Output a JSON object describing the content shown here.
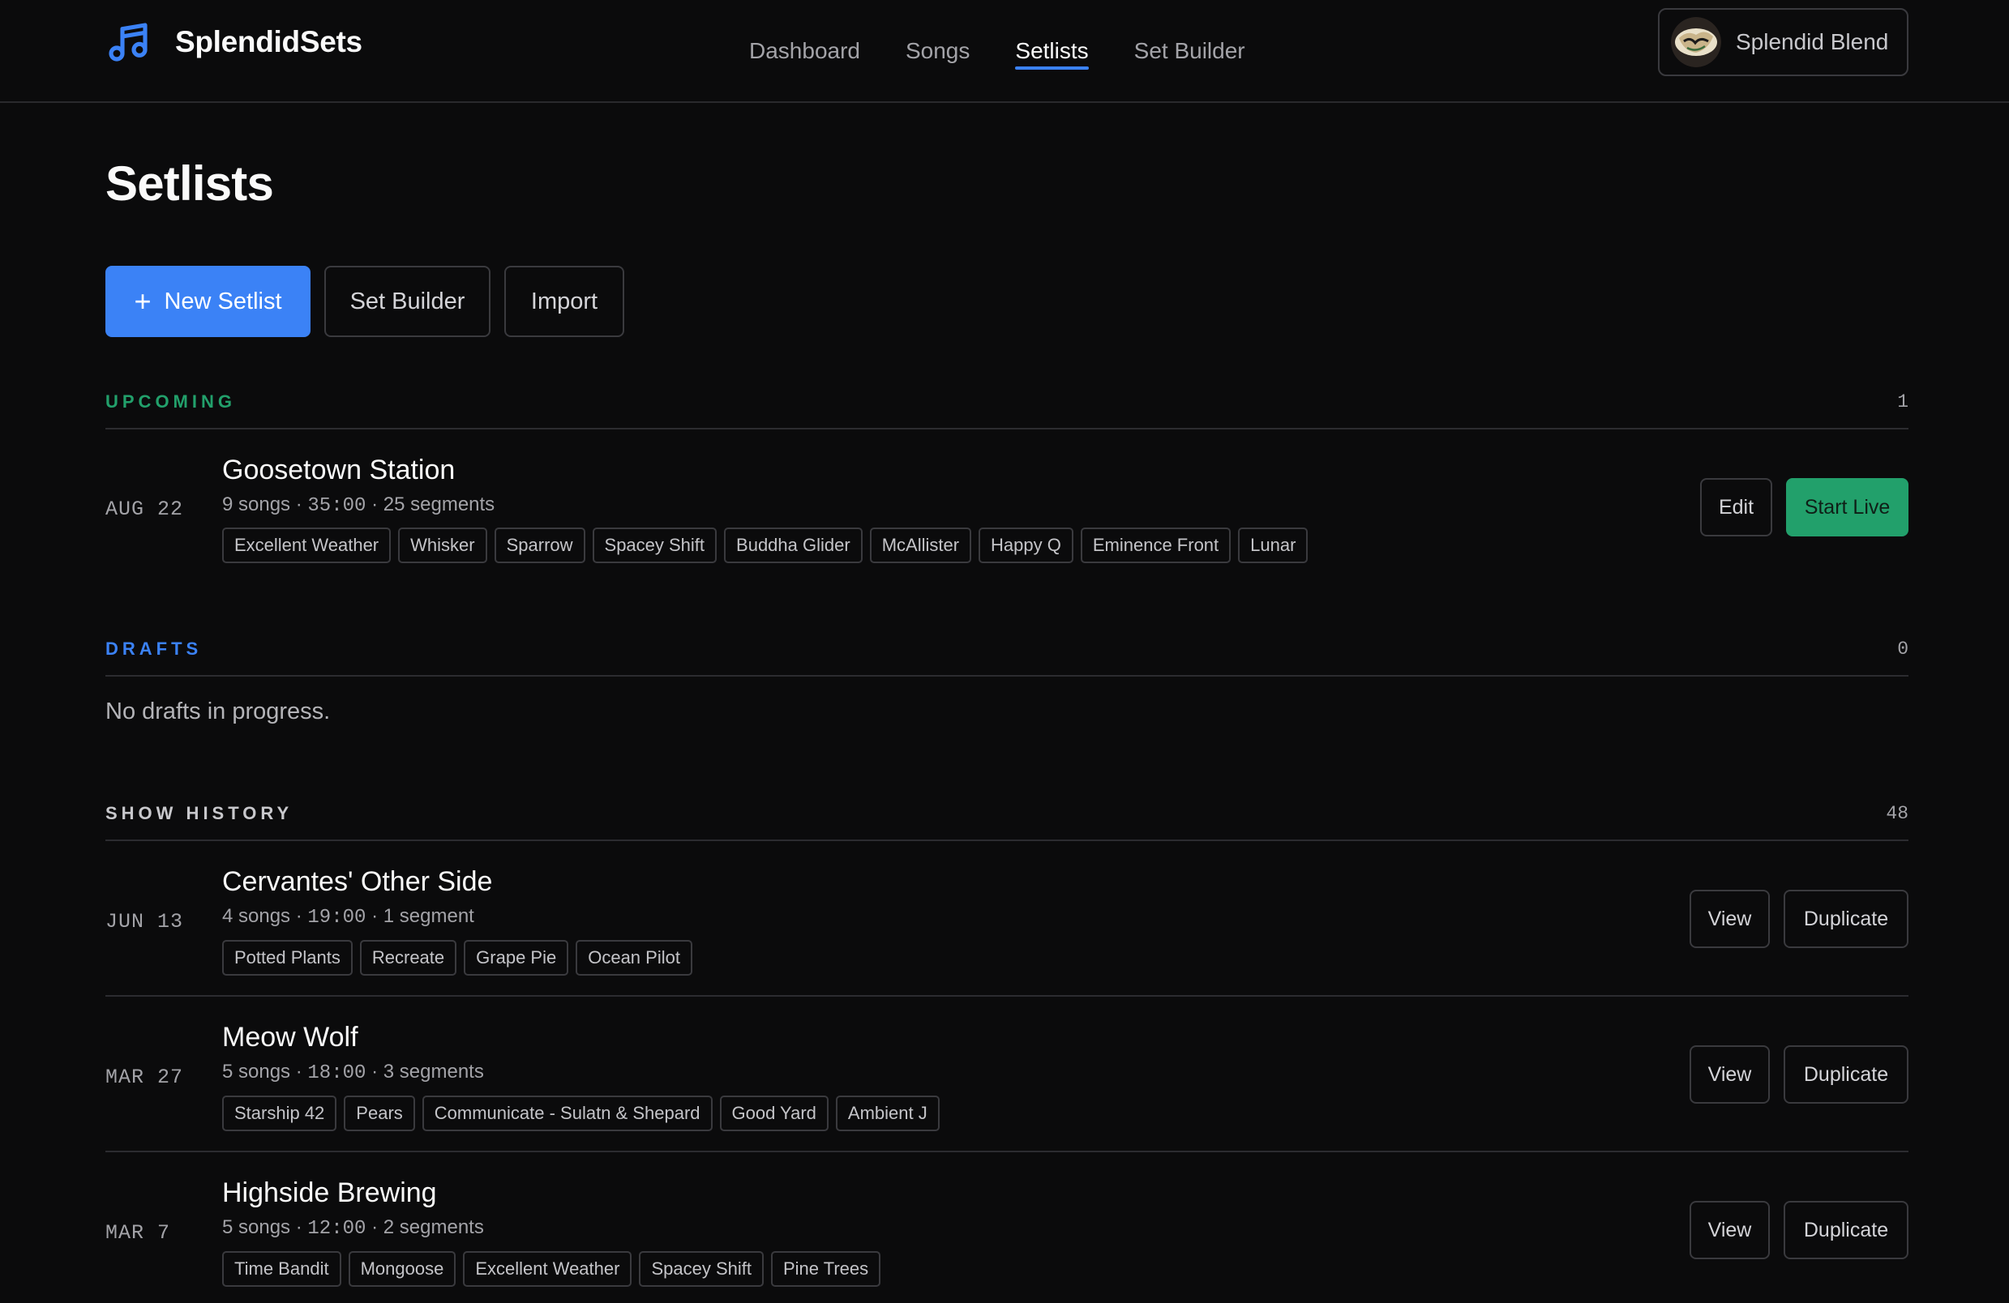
{
  "app": {
    "name": "SplendidSets",
    "brand_icon": "music-note-icon",
    "accent_color": "#3b82f6",
    "success_color": "#22a06b"
  },
  "nav": {
    "items": [
      {
        "label": "Dashboard"
      },
      {
        "label": "Songs"
      },
      {
        "label": "Setlists"
      },
      {
        "label": "Set Builder"
      }
    ],
    "active": "Setlists"
  },
  "account": {
    "name": "Splendid Blend"
  },
  "page": {
    "title": "Setlists",
    "actions": {
      "new_setlist": "New Setlist",
      "set_builder": "Set Builder",
      "import": "Import"
    }
  },
  "upcoming": {
    "label": "UPCOMING",
    "count": "1",
    "color": "#22a06b",
    "items": [
      {
        "date": "AUG 22",
        "title": "Goosetown Station",
        "songs": "9 songs",
        "duration": "35:00",
        "segments": "25 segments",
        "tags": [
          "Excellent Weather",
          "Whisker",
          "Sparrow",
          "Spacey Shift",
          "Buddha Glider",
          "McAllister",
          "Happy Q",
          "Eminence Front",
          "Lunar"
        ],
        "edit": "Edit",
        "start": "Start Live"
      }
    ]
  },
  "drafts": {
    "label": "DRAFTS",
    "count": "0",
    "color": "#3b82f6",
    "empty": "No drafts in progress."
  },
  "history": {
    "label": "SHOW HISTORY",
    "count": "48",
    "view": "View",
    "duplicate": "Duplicate",
    "items": [
      {
        "date": "JUN 13",
        "title": "Cervantes' Other Side",
        "songs": "4 songs",
        "duration": "19:00",
        "segments": "1 segment",
        "tags": [
          "Potted Plants",
          "Recreate",
          "Grape Pie",
          "Ocean Pilot"
        ]
      },
      {
        "date": "MAR 27",
        "title": "Meow Wolf",
        "songs": "5 songs",
        "duration": "18:00",
        "segments": "3 segments",
        "tags": [
          "Starship 42",
          "Pears",
          "Communicate - Sulatn & Shepard",
          "Good Yard",
          "Ambient J"
        ]
      },
      {
        "date": "MAR 7",
        "title": "Highside Brewing",
        "songs": "5 songs",
        "duration": "12:00",
        "segments": "2 segments",
        "tags": [
          "Time Bandit",
          "Mongoose",
          "Excellent Weather",
          "Spacey Shift",
          "Pine Trees"
        ]
      }
    ]
  }
}
